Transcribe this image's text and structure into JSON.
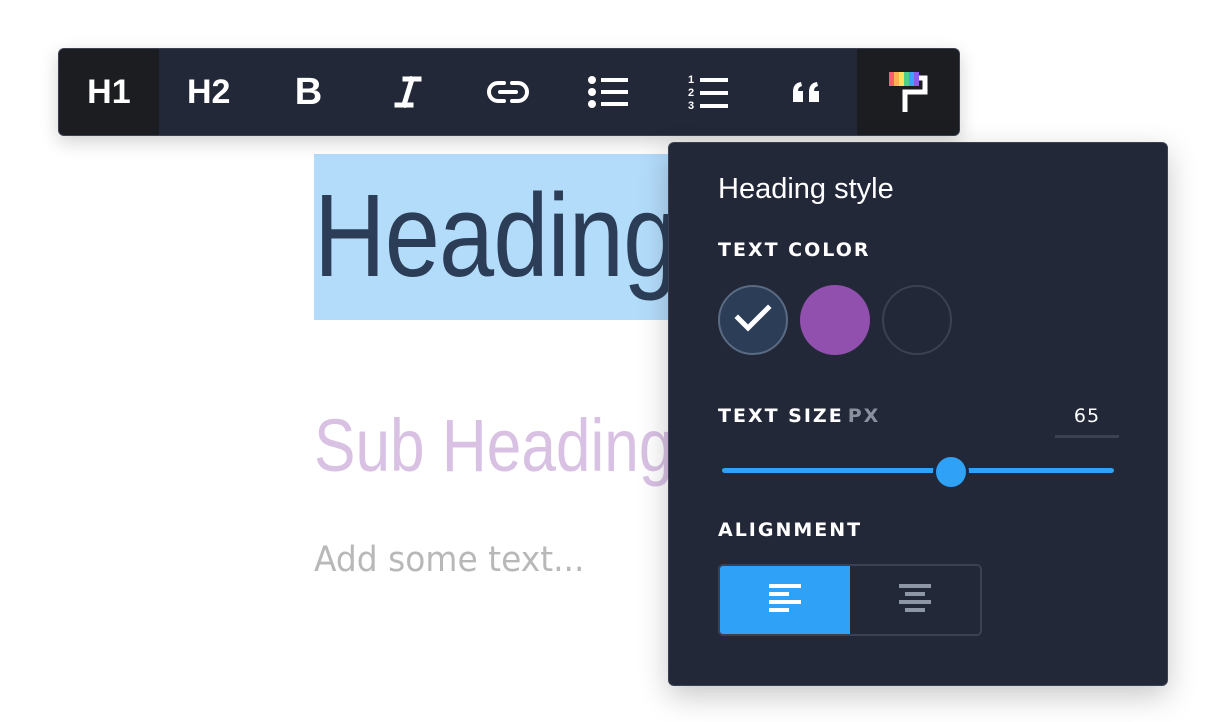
{
  "editor": {
    "heading": "Heading",
    "subheading": "Sub Heading",
    "body_placeholder": "Add some text..."
  },
  "toolbar": {
    "buttons": [
      {
        "name": "heading-1",
        "label": "H1",
        "icon": "heading-1-icon",
        "active": true
      },
      {
        "name": "heading-2",
        "label": "H2",
        "icon": "heading-2-icon",
        "active": false
      },
      {
        "name": "bold",
        "label": "B",
        "icon": "bold-icon",
        "active": false
      },
      {
        "name": "italic",
        "label": "I",
        "icon": "italic-icon",
        "active": false
      },
      {
        "name": "link",
        "icon": "link-icon",
        "active": false
      },
      {
        "name": "bulleted-list",
        "icon": "bulleted-list-icon",
        "active": false
      },
      {
        "name": "numbered-list",
        "label_digits": [
          "1",
          "2",
          "3"
        ],
        "icon": "numbered-list-icon",
        "active": false
      },
      {
        "name": "quote",
        "icon": "quote-icon",
        "active": false
      },
      {
        "name": "style",
        "icon": "paint-roller-icon",
        "active": true
      }
    ]
  },
  "panel": {
    "title": "Heading style",
    "text_color": {
      "label": "TEXT COLOR",
      "swatches": [
        {
          "color": "#2c3e57",
          "selected": true
        },
        {
          "color": "#9150ae",
          "selected": false
        },
        {
          "color": "#232838",
          "selected": false
        }
      ]
    },
    "text_size": {
      "label": "TEXT SIZE",
      "unit": "PX",
      "value": "65",
      "slider_fraction": 0.583
    },
    "alignment": {
      "label": "ALIGNMENT",
      "options": [
        {
          "name": "left",
          "icon": "align-left-icon",
          "active": true
        },
        {
          "name": "center",
          "icon": "align-center-icon",
          "active": false
        }
      ]
    }
  },
  "colors": {
    "toolbar_bg": "#232838",
    "active_bg": "#1c1d21",
    "accent": "#2fa2f7",
    "selection": "#b3dcfb"
  }
}
